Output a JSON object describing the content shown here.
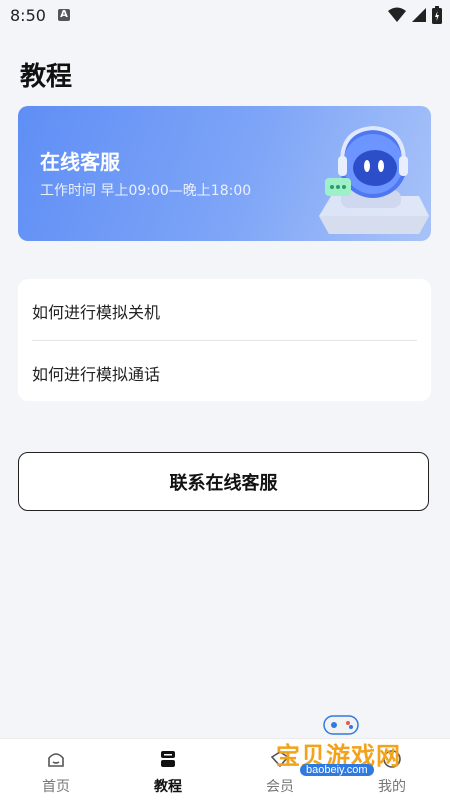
{
  "status_bar": {
    "time": "8:50",
    "a_badge": "A"
  },
  "page": {
    "title": "教程"
  },
  "banner": {
    "title": "在线客服",
    "subtitle": "工作时间 早上09:00—晚上18:00"
  },
  "tutorials": [
    {
      "label": "如何进行模拟关机"
    },
    {
      "label": "如何进行模拟通话"
    }
  ],
  "contact_button": {
    "label": "联系在线客服"
  },
  "tabs": [
    {
      "label": "首页",
      "icon": "home-icon",
      "active": false
    },
    {
      "label": "教程",
      "icon": "book-icon",
      "active": true
    },
    {
      "label": "会员",
      "icon": "vip-icon",
      "active": false
    },
    {
      "label": "我的",
      "icon": "user-icon",
      "active": false
    }
  ],
  "watermark": {
    "text": "宝贝游戏网",
    "url": "baobeiy.com"
  }
}
